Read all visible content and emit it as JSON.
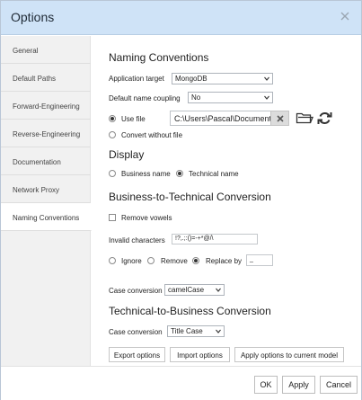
{
  "dialog": {
    "title": "Options"
  },
  "sidebar": {
    "items": [
      {
        "label": "General"
      },
      {
        "label": "Default Paths"
      },
      {
        "label": "Forward-Engineering"
      },
      {
        "label": "Reverse-Engineering"
      },
      {
        "label": "Documentation"
      },
      {
        "label": "Network Proxy"
      },
      {
        "label": "Naming Conventions"
      }
    ],
    "active_index": 6
  },
  "naming": {
    "heading": "Naming Conventions",
    "app_target_label": "Application target",
    "app_target_value": "MongoDB",
    "coupling_label": "Default name coupling",
    "coupling_value": "No",
    "use_file_label": "Use file",
    "file_path": "C:\\Users\\Pascal\\Documents\\",
    "convert_label": "Convert without file"
  },
  "display": {
    "heading": "Display",
    "business_label": "Business name",
    "technical_label": "Technical name",
    "selected": "technical"
  },
  "b2t": {
    "heading": "Business-to-Technical Conversion",
    "remove_vowels_label": "Remove vowels",
    "invalid_label": "Invalid characters",
    "invalid_value": "!?,.;:()=-+*@/\\",
    "ignore_label": "Ignore",
    "remove_label": "Remove",
    "replace_label": "Replace by",
    "replace_value": "_",
    "selected": "replace",
    "case_label": "Case conversion",
    "case_value": "camelCase"
  },
  "t2b": {
    "heading": "Technical-to-Business Conversion",
    "case_label": "Case conversion",
    "case_value": "Title Case"
  },
  "actions": {
    "export_label": "Export options",
    "import_label": "Import options",
    "apply_model_label": "Apply options to current model"
  },
  "footer": {
    "ok_label": "OK",
    "apply_label": "Apply",
    "cancel_label": "Cancel"
  }
}
